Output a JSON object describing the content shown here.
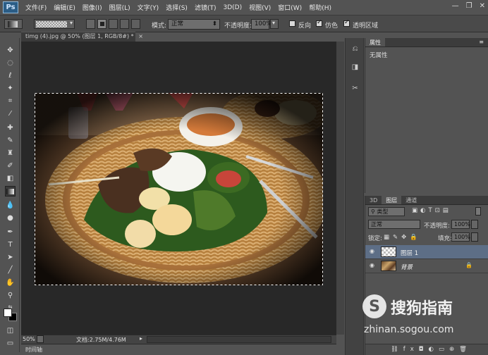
{
  "app": {
    "logo": "Ps"
  },
  "menu": [
    "文件(F)",
    "编辑(E)",
    "图像(I)",
    "图层(L)",
    "文字(Y)",
    "选择(S)",
    "滤镜(T)",
    "3D(D)",
    "视图(V)",
    "窗口(W)",
    "帮助(H)"
  ],
  "options": {
    "mode_label": "模式:",
    "mode_value": "正常",
    "opacity_label": "不透明度:",
    "opacity_value": "100%",
    "reverse_label": "反向",
    "dither_label": "仿色",
    "transparency_label": "透明区域"
  },
  "document": {
    "tab_title": "timg (4).jpg @ 50% (图层 1, RGB/8#) *",
    "zoom": "50%",
    "doc_info": "文档:2.75M/4.76M"
  },
  "timeline": {
    "label": "时间轴"
  },
  "properties": {
    "tab_label": "属性",
    "content": "无属性"
  },
  "layers": {
    "tabs": [
      "3D",
      "图层",
      "通道"
    ],
    "filter_label": "类型",
    "blend_mode": "正常",
    "opacity_label": "不透明度:",
    "opacity_value": "100%",
    "lock_label": "锁定:",
    "fill_label": "填充:",
    "fill_value": "100%",
    "items": [
      {
        "name": "图层 1",
        "selected": true
      },
      {
        "name": "背景",
        "selected": false
      }
    ]
  },
  "watermark": {
    "brand": "搜狗指南",
    "url": "zhinan.sogou.com"
  }
}
